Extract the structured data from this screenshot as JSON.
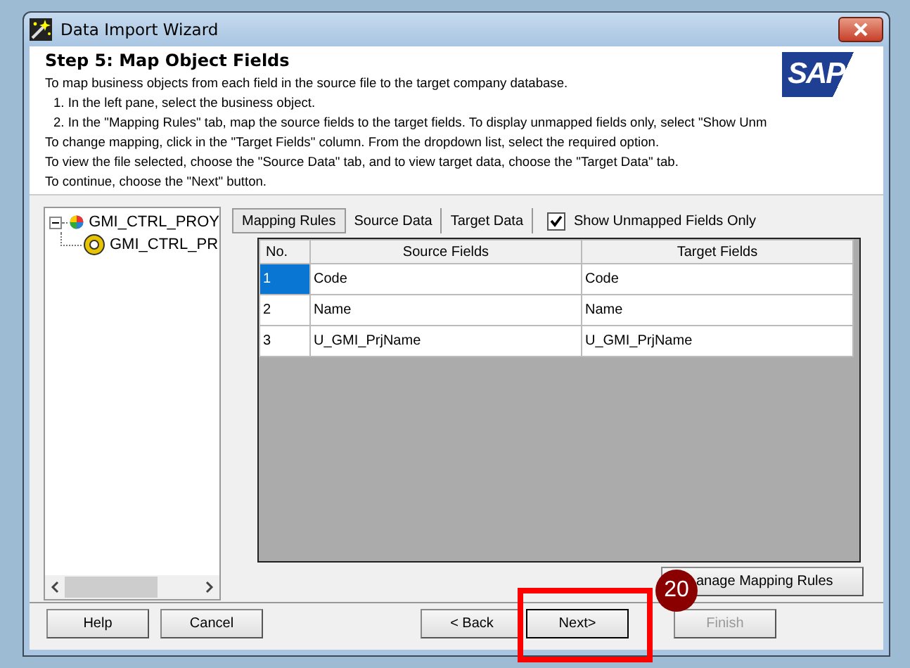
{
  "window": {
    "title": "Data Import Wizard"
  },
  "header": {
    "title": "Step 5: Map Object Fields",
    "lines": [
      {
        "kind": "text",
        "text": "To map business objects from each field in the source file to the target company database."
      },
      {
        "kind": "step",
        "text": "1. In the left pane, select the business object."
      },
      {
        "kind": "step",
        "text": "2. In the \"Mapping Rules\" tab, map the source fields to the target fields. To display unmapped fields only, select \"Show Unm"
      },
      {
        "kind": "text",
        "text": "To change mapping, click in the \"Target Fields\" column. From the dropdown list, select the required option."
      },
      {
        "kind": "text",
        "text": "To view the file selected, choose the \"Source Data\" tab, and to view target data, choose the \"Target Data\" tab."
      },
      {
        "kind": "text",
        "text": "To continue, choose the \"Next\" button."
      }
    ],
    "logo": "SAP"
  },
  "tree": [
    {
      "label": "GMI_CTRL_PROY",
      "expanded": true,
      "children": [
        {
          "label": "GMI_CTRL_PR"
        }
      ]
    }
  ],
  "tabs": [
    {
      "label": "Mapping Rules",
      "selected": true
    },
    {
      "label": "Source Data",
      "selected": false
    },
    {
      "label": "Target Data",
      "selected": false
    }
  ],
  "unmapped_only": {
    "label": "Show Unmapped Fields Only",
    "checked": true
  },
  "table": {
    "columns": [
      "No.",
      "Source  Fields",
      "Target Fields"
    ],
    "rows": [
      {
        "no": "1",
        "source": "Code",
        "target": "Code",
        "selected": true
      },
      {
        "no": "2",
        "source": "Name",
        "target": "Name",
        "selected": false
      },
      {
        "no": "3",
        "source": "U_GMI_PrjName",
        "target": "U_GMI_PrjName",
        "selected": false
      }
    ]
  },
  "manage_button": "anage Mapping Rules",
  "buttons": [
    {
      "label": "Help",
      "disabled": false,
      "default": false
    },
    {
      "label": "Cancel",
      "disabled": false,
      "default": false
    },
    {
      "label": "< Back",
      "disabled": false,
      "default": false
    },
    {
      "label": "Next>",
      "disabled": false,
      "default": true
    },
    {
      "label": "Finish",
      "disabled": true,
      "default": false
    }
  ],
  "annotation": {
    "badge": "20"
  }
}
